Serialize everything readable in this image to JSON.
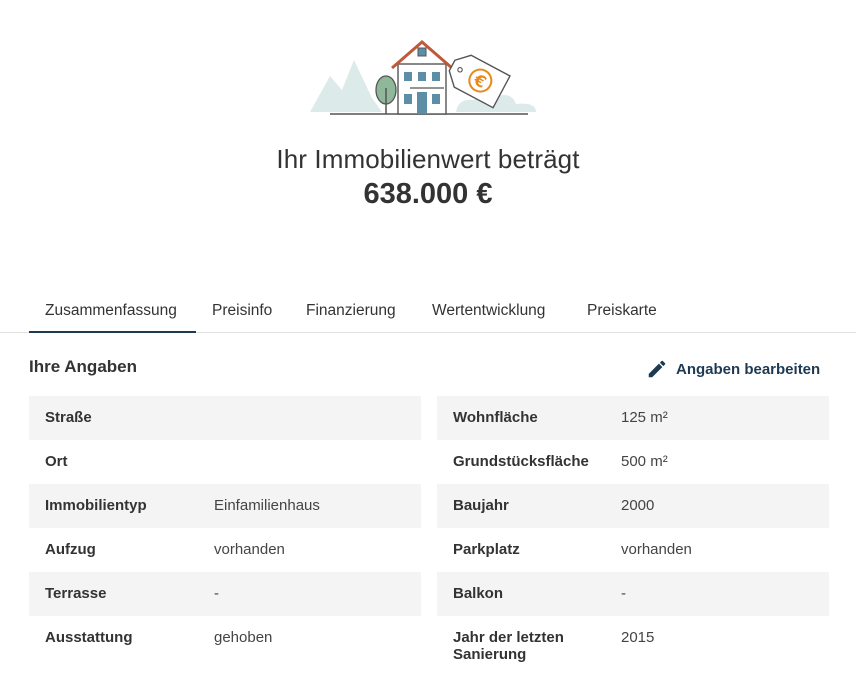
{
  "hero": {
    "icons": [
      "house-icon",
      "euro-price-tag-icon",
      "tree-icon"
    ],
    "title": "Ihr Immobilienwert beträgt",
    "value": "638.000 €"
  },
  "tabs": [
    {
      "label": "Zusammenfassung",
      "active": true
    },
    {
      "label": "Preisinfo",
      "active": false
    },
    {
      "label": "Finanzierung",
      "active": false
    },
    {
      "label": "Wertentwicklung",
      "active": false
    },
    {
      "label": "Preiskarte",
      "active": false
    }
  ],
  "section": {
    "title": "Ihre Angaben",
    "edit_label": "Angaben bearbeiten",
    "edit_icon": "pencil-icon"
  },
  "details_left": [
    {
      "label": "Straße",
      "value": ""
    },
    {
      "label": "Ort",
      "value": ""
    },
    {
      "label": "Immobilientyp",
      "value": "Einfamilienhaus"
    },
    {
      "label": "Aufzug",
      "value": "vorhanden"
    },
    {
      "label": "Terrasse",
      "value": "-"
    },
    {
      "label": "Ausstattung",
      "value": "gehoben"
    }
  ],
  "details_right": [
    {
      "label": "Wohnfläche",
      "value": "125 m²"
    },
    {
      "label": "Grundstücksfläche",
      "value": "500 m²"
    },
    {
      "label": "Baujahr",
      "value": "2000"
    },
    {
      "label": "Parkplatz",
      "value": "vorhanden"
    },
    {
      "label": "Balkon",
      "value": "-"
    },
    {
      "label": "Jahr der letzten Sanierung",
      "value": "2015"
    }
  ],
  "colors": {
    "accent": "#1e3a52",
    "text": "#333333",
    "row_shade": "#f4f4f4",
    "euro_orange": "#e8891e",
    "illustration_mint": "#dcebea"
  }
}
